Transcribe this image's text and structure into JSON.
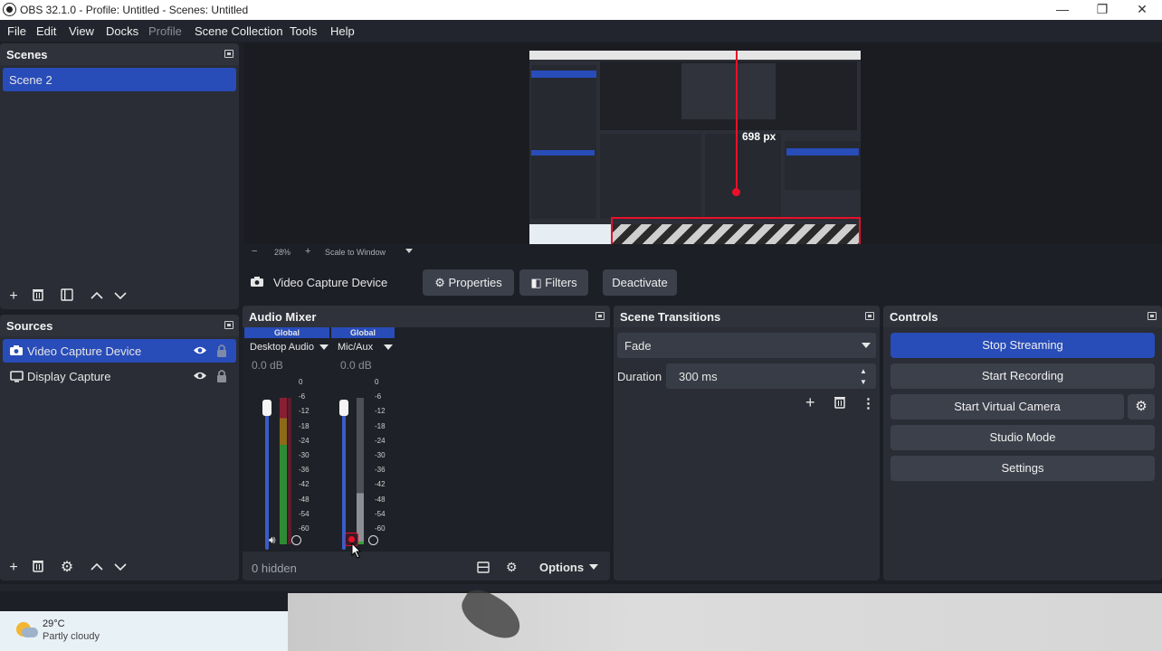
{
  "window": {
    "title": "OBS 32.1.0 - Profile: Untitled - Scenes: Untitled",
    "minimize_glyph": "—",
    "maximize_glyph": "❐",
    "close_glyph": "✕"
  },
  "menu": [
    "File",
    "Edit",
    "View",
    "Docks",
    "Profile",
    "Scene Collection",
    "Tools",
    "Help"
  ],
  "scenes": {
    "title": "Scenes",
    "items": [
      {
        "label": "Scene 2",
        "selected": true
      }
    ]
  },
  "preview": {
    "zoom_minus": "−",
    "zoom_level": "28%",
    "zoom_plus": "+",
    "scale_mode": "Scale to Window",
    "measure_label": "698 px"
  },
  "source_bar": {
    "source_name": "Video Capture Device",
    "properties": "Properties",
    "filters": "Filters",
    "deactivate": "Deactivate"
  },
  "sources": {
    "title": "Sources",
    "items": [
      {
        "label": "Video Capture Device",
        "icon": "camera-icon",
        "selected": true
      },
      {
        "label": "Display Capture",
        "icon": "monitor-icon",
        "selected": false
      }
    ]
  },
  "audio_mixer": {
    "title": "Audio Mixer",
    "channels": [
      {
        "tag": "Global",
        "name": "Desktop Audio",
        "level": "0.0 dB",
        "volume_fraction": 0.97
      },
      {
        "tag": "Global",
        "name": "Mic/Aux",
        "level": "0.0 dB",
        "volume_fraction": 0.97
      }
    ],
    "ticks": [
      "0",
      "-6",
      "-12",
      "-18",
      "-24",
      "-30",
      "-36",
      "-42",
      "-48",
      "-54",
      "-60"
    ],
    "hidden_label": "0 hidden",
    "options": "Options"
  },
  "transitions": {
    "title": "Scene Transitions",
    "selected": "Fade",
    "duration_label": "Duration",
    "duration_value": "300 ms"
  },
  "controls": {
    "title": "Controls",
    "stop_streaming": "Stop Streaming",
    "start_recording": "Start Recording",
    "start_virtual_camera": "Start Virtual Camera",
    "studio_mode": "Studio Mode",
    "settings": "Settings"
  },
  "weather": {
    "temp": "29°C",
    "condition": "Partly cloudy"
  },
  "colors": {
    "accent": "#284cb8",
    "measure_red": "#e8102a",
    "meter_green": "#2fa33a",
    "meter_yellow": "#c8a21d",
    "meter_red": "#b3203a"
  }
}
